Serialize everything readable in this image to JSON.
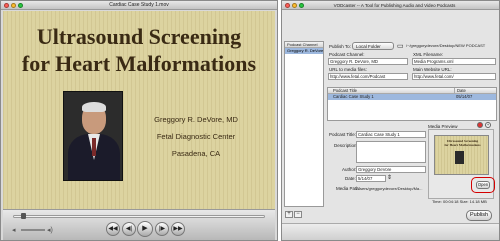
{
  "quicktime": {
    "window_title": "Cardiac Case Study 1.mov",
    "slide": {
      "title_line1": "Ultrasound Screening",
      "title_line2": "for Heart Malformations",
      "presenter_name": "Greggory R. DeVore, MD",
      "organization": "Fetal Diagnostic Center",
      "location": "Pasadena, CA"
    },
    "playback_progress": 0.03,
    "controls": {
      "rewind": "◀◀",
      "prev": "◀|",
      "play": "▶",
      "next": "|▶",
      "ffwd": "▶▶"
    }
  },
  "vodcaster": {
    "window_title": "VODcaster -- A Tool for Publishing Audio and Video Podcasts",
    "sidebar": {
      "header": "Podcast Channel",
      "selected_item": "Greggory R. DeVore...",
      "add": "+",
      "remove": "−"
    },
    "publish_to": {
      "label": "Publish To:",
      "value": "Local Folder",
      "path": "/~/greggorydevore/Desktop/NEW PODCAST"
    },
    "podcast_channel": {
      "label": "Podcast Channel:",
      "value": "Greggory R. DeVore, MD"
    },
    "xml_filename": {
      "label": "XML Filename:",
      "value": "Media Programs.xml"
    },
    "url_media_files": {
      "label": "URL to media files:",
      "value": "http://www.fetal.com/Podcast"
    },
    "main_website_url": {
      "label": "Main Website URL:",
      "value": "http://www.fetal.com/"
    },
    "episodes_table": {
      "columns": [
        "Podcast Title",
        "Date"
      ],
      "rows": [
        [
          "Cardiac Case Study 1",
          "05/14/07"
        ]
      ]
    },
    "episode": {
      "title_label": "Podcast Title:",
      "title_value": "Cardiac Case Study 1",
      "description_label": "Description:",
      "author_label": "Author:",
      "author_value": "Greggory DeVore",
      "date_label": "Date:",
      "date_value": "5/14/07",
      "media_path_label": "Media Path:",
      "media_path_value": "/Users/greggorydevore/Desktop/Ma..."
    },
    "media_preview": {
      "label": "Media Preview",
      "thumb_title1": "Ultrasound Screening",
      "thumb_title2": "for Heart Malformations",
      "open_button": "Open",
      "time_size": "Time: 00:04:18 Size: 14.18 MB"
    },
    "publish_button": "Publish"
  },
  "colors": {
    "slide_bg": "#dcd3a0",
    "slide_text": "#3a2a14",
    "selection": "#9db8de",
    "highlight_ring": "#d40000"
  }
}
